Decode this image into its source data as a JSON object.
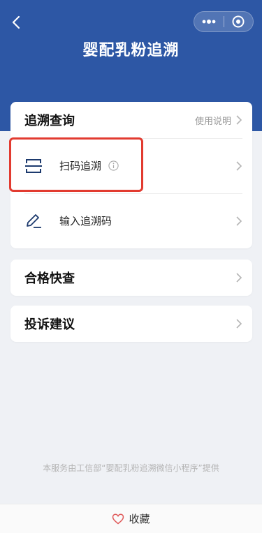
{
  "header": {
    "title": "婴配乳粉追溯",
    "accent_color": "#2d57a5"
  },
  "query_card": {
    "title": "追溯查询",
    "help_label": "使用说明",
    "items": [
      {
        "label": "扫码追溯",
        "icon": "scan-icon",
        "info_icon": "info-icon"
      },
      {
        "label": "输入追溯码",
        "icon": "pen-icon"
      }
    ]
  },
  "check_card": {
    "title": "合格快查"
  },
  "complain_card": {
    "title": "投诉建议"
  },
  "footnote": "本服务由工信部“婴配乳粉追溯微信小程序”提供",
  "bottom_bar": {
    "favorite_label": "收藏",
    "icon": "heart-icon"
  },
  "colors": {
    "highlight": "#e23b30",
    "background": "#eff1f5"
  }
}
